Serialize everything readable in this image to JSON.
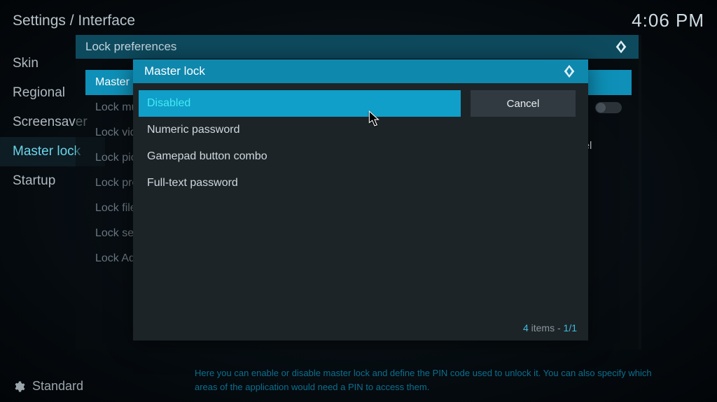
{
  "header": {
    "title": "Settings / Interface",
    "clock": "4:06 PM"
  },
  "sidebar": {
    "items": [
      "Skin",
      "Regional",
      "Screensaver",
      "Master lock",
      "Startup"
    ],
    "active_index": 3
  },
  "footer": {
    "level_label": "Standard",
    "description_line1": "Here you can enable or disable master lock and define the PIN code used to unlock it. You can also specify which",
    "description_line2": "areas of the application would need a PIN to access them."
  },
  "lock_prefs_dialog": {
    "title": "Lock preferences",
    "rows": [
      "Master lock",
      "Lock music section",
      "Lock videos section",
      "Lock pictures section",
      "Lock programs & scripts sections",
      "Lock file manager",
      "Lock settings",
      "Lock Add-on manager"
    ],
    "service_label": "Master lock",
    "cancel_label": "Cancel"
  },
  "master_lock_dialog": {
    "title": "Master lock",
    "options": [
      "Disabled",
      "Numeric password",
      "Gamepad button combo",
      "Full-text password"
    ],
    "selected_index": 0,
    "cancel_label": "Cancel",
    "footer_count": "4",
    "footer_items_text": "items -",
    "footer_page": "1/1"
  }
}
